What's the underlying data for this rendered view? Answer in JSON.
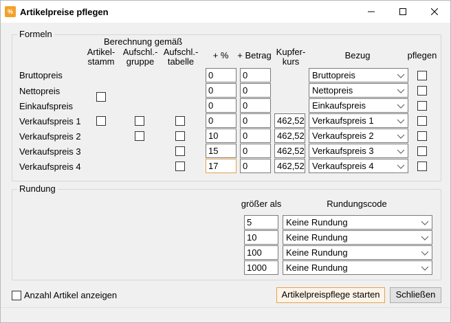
{
  "window": {
    "title": "Artikelpreise pflegen"
  },
  "formeln": {
    "legend": "Formeln",
    "header": {
      "berechnung": "Berechnung gemäß",
      "artikelstamm_l1": "Artikel-",
      "artikelstamm_l2": "stamm",
      "aufschl_gruppe_l1": "Aufschl.-",
      "aufschl_gruppe_l2": "gruppe",
      "aufschl_tabelle_l1": "Aufschl.-",
      "aufschl_tabelle_l2": "tabelle",
      "plus_prozent": "+ %",
      "plus_betrag": "+ Betrag",
      "kupferkurs_l1": "Kupfer-",
      "kupferkurs_l2": "kurs",
      "bezug": "Bezug",
      "pflegen": "pflegen"
    },
    "rows": [
      {
        "label": "Bruttopreis",
        "prozent": "0",
        "betrag": "0",
        "kupfer": "",
        "bezug": "Bruttopreis"
      },
      {
        "label": "Nettopreis",
        "prozent": "0",
        "betrag": "0",
        "kupfer": "",
        "bezug": "Nettopreis"
      },
      {
        "label": "Einkaufspreis",
        "prozent": "0",
        "betrag": "0",
        "kupfer": "",
        "bezug": "Einkaufspreis"
      },
      {
        "label": "Verkaufspreis 1",
        "prozent": "0",
        "betrag": "0",
        "kupfer": "462,52",
        "bezug": "Verkaufspreis 1"
      },
      {
        "label": "Verkaufspreis 2",
        "prozent": "10",
        "betrag": "0",
        "kupfer": "462,52",
        "bezug": "Verkaufspreis 2"
      },
      {
        "label": "Verkaufspreis 3",
        "prozent": "15",
        "betrag": "0",
        "kupfer": "462,52",
        "bezug": "Verkaufspreis 3"
      },
      {
        "label": "Verkaufspreis 4",
        "prozent": "17",
        "betrag": "0",
        "kupfer": "462,52",
        "bezug": "Verkaufspreis 4"
      }
    ]
  },
  "rundung": {
    "legend": "Rundung",
    "header_groesser": "größer als",
    "header_code": "Rundungscode",
    "rows": [
      {
        "groesser": "5",
        "code": "Keine Rundung"
      },
      {
        "groesser": "10",
        "code": "Keine Rundung"
      },
      {
        "groesser": "100",
        "code": "Keine Rundung"
      },
      {
        "groesser": "1000",
        "code": "Keine Rundung"
      }
    ]
  },
  "footer": {
    "anzahl_label": "Anzahl Artikel anzeigen",
    "start_button": "Artikelpreispflege starten",
    "close_button": "Schließen"
  },
  "colors": {
    "accent": "#e3a34f",
    "background": "#f0f0f0"
  }
}
